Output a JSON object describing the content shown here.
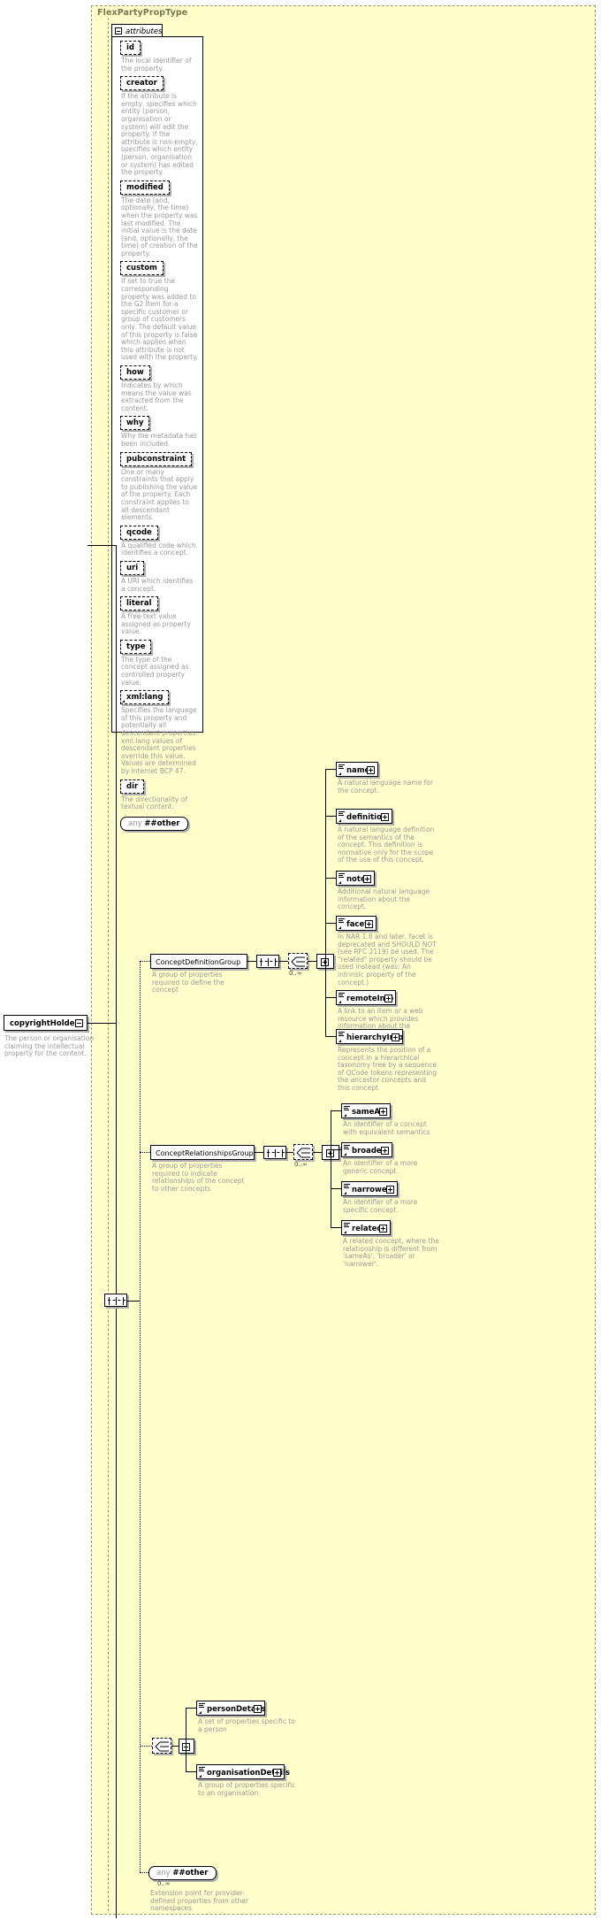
{
  "type_name": "FlexPartyPropType",
  "attributes_label": "attributes",
  "attributes": [
    {
      "name": "id",
      "doc": "The local identifier of the property."
    },
    {
      "name": "creator",
      "doc": "If the attribute is empty, specifies which entity (person, organisation or system) will edit the property. If the attribute is non-empty, specifies which entity (person, organisation or system) has edited the property."
    },
    {
      "name": "modified",
      "doc": "The date (and, optionally, the time) when the property was last modified. The initial value is the date (and, optionally, the time) of creation of the property."
    },
    {
      "name": "custom",
      "doc": "If set to true the corresponding property was added to the G2 Item for a specific customer or group of customers only. The default value of this property is false which applies when this attribute is not used with the property."
    },
    {
      "name": "how",
      "doc": "Indicates by which means the value was extracted from the content."
    },
    {
      "name": "why",
      "doc": "Why the metadata has been included."
    },
    {
      "name": "pubconstraint",
      "doc": "One or many constraints that apply to publishing the value of the property. Each constraint applies to all descendant elements."
    },
    {
      "name": "qcode",
      "doc": "A qualified code which identifies a concept."
    },
    {
      "name": "uri",
      "doc": "A URI which identifies a concept."
    },
    {
      "name": "literal",
      "doc": "A free-text value assigned as property value."
    },
    {
      "name": "type",
      "doc": "The type of the concept assigned as controlled property value."
    },
    {
      "name": "xml:lang",
      "doc": "Specifies the language of this property and potentially all descendant properties. xml:lang values of descendant properties override this value. Values are determined by Internet BCP 47."
    },
    {
      "name": "dir",
      "doc": "The directionality of textual content."
    }
  ],
  "attributes_any": {
    "keyword": "any",
    "namespace": "##other"
  },
  "root_element": {
    "name": "copyrightHolder",
    "doc": "The person or organisation claiming the intellectual property for the content."
  },
  "groups": [
    {
      "name": "ConceptDefinitionGroup",
      "doc": "A group of properties required to define the concept",
      "occurs": "0..∞",
      "children": [
        {
          "name": "name",
          "doc": "A natural language name for the concept."
        },
        {
          "name": "definition",
          "doc": "A natural language definition of the semantics of the concept. This definition is normative only for the scope of the use of this concept."
        },
        {
          "name": "note",
          "doc": "Additional natural language information about the concept."
        },
        {
          "name": "facet",
          "doc": "In NAR 1.8 and later, facet is deprecated and SHOULD NOT (see RFC 2119) be used. The \"related\" property should be used instead (was: An intrinsic property of the concept.)"
        },
        {
          "name": "remoteInfo",
          "doc": "A link to an item or a web resource which provides information about the concept"
        },
        {
          "name": "hierarchyInfo",
          "doc": "Represents the position of a concept in a hierarchical taxonomy tree by a sequence of QCode tokens representing the ancestor concepts and this concept"
        }
      ]
    },
    {
      "name": "ConceptRelationshipsGroup",
      "doc": "A group of properties required to indicate relationships of the concept to other concepts",
      "occurs": "0..∞",
      "children": [
        {
          "name": "sameAs",
          "doc": "An identifier of a concept with equivalent semantics"
        },
        {
          "name": "broader",
          "doc": "An identifier of a more generic concept."
        },
        {
          "name": "narrower",
          "doc": "An identifier of a more specific concept."
        },
        {
          "name": "related",
          "doc": "A related concept, where the relationship is different from 'sameAs', 'broader' or 'narrower'."
        }
      ]
    }
  ],
  "detail_choice": {
    "children": [
      {
        "name": "personDetails",
        "doc": "A set of properties specific to a person"
      },
      {
        "name": "organisationDetails",
        "doc": "A group of properties specific to an organisation"
      }
    ]
  },
  "extension_any": {
    "keyword": "any",
    "namespace": "##other",
    "occurs": "0..∞",
    "doc": "Extension point for provider-defined properties from other namespaces"
  },
  "colors": {
    "type_background": "#ffffcc",
    "type_border": "#9a9a6a",
    "doc_text": "#9a9a9a",
    "title_text": "#777755",
    "box_shadow": "#b0b0b0"
  }
}
